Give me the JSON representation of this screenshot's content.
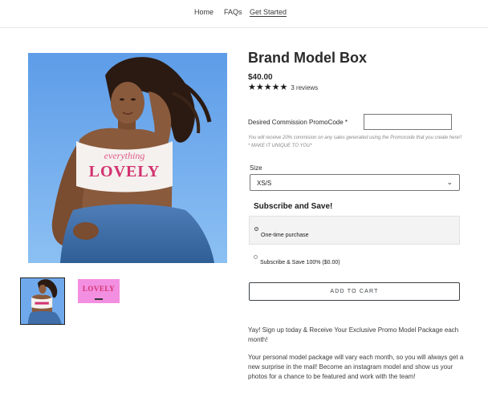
{
  "nav": {
    "items": [
      {
        "label": "Home"
      },
      {
        "label": "FAQs"
      },
      {
        "label": "Get Started",
        "active": true
      }
    ]
  },
  "product": {
    "title": "Brand Model Box",
    "price": "$40.00",
    "rating": 5,
    "rating_max": 5,
    "reviews_text": "3 reviews",
    "hero_image": {
      "shirt_top_text": "everything",
      "shirt_main_text": "LOVELY"
    },
    "thumbnails": [
      {
        "name": "model-photo",
        "selected": true
      },
      {
        "name": "lovely-logo",
        "text": "LOVELY",
        "background": "#f38fe0"
      }
    ]
  },
  "promo": {
    "label": "Desired Commission PromoCode *",
    "value": "",
    "helper_text": "You will receive 20% commision on any sales generated using the Promocode that you create here!! * MAKE IT UNIQUE TO YOU*"
  },
  "size": {
    "label": "Size",
    "selected": "XS/S",
    "chevron_icon": "chevron-down-icon"
  },
  "subscription": {
    "heading": "Subscribe and Save!",
    "options": [
      {
        "label": "One-time purchase",
        "selected": true
      },
      {
        "label": "Subscribe & Save 100% ($0.00)",
        "selected": false
      }
    ]
  },
  "cart": {
    "button_label": "ADD TO CART"
  },
  "description": {
    "p1": "Yay! Sign up today & Receive Your Exclusive Promo Model Package each month!",
    "p2": "Your personal model package will vary each month, so you will always get a new surprise in the mail! Become an instagram model and show us your photos for a chance to be featured and work with the team!"
  },
  "colors": {
    "sky": "#6fa9ec",
    "brand_pink": "#d2326f",
    "thumb_pink": "#f38fe0",
    "text": "#3a3a3a"
  }
}
